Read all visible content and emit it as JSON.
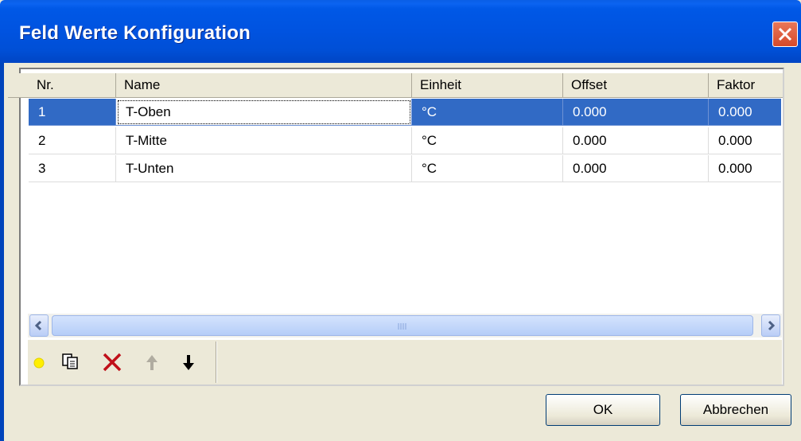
{
  "window": {
    "title": "Feld Werte Konfiguration"
  },
  "table": {
    "columns": [
      "Nr.",
      "Name",
      "Einheit",
      "Offset",
      "Faktor"
    ],
    "rows": [
      {
        "nr": "1",
        "name": "T-Oben",
        "einheit": "°C",
        "offset": "0.000",
        "faktor": "0.000",
        "selected": true
      },
      {
        "nr": "2",
        "name": "T-Mitte",
        "einheit": "°C",
        "offset": "0.000",
        "faktor": "0.000",
        "selected": false
      },
      {
        "nr": "3",
        "name": "T-Unten",
        "einheit": "°C",
        "offset": "0.000",
        "faktor": "0.000",
        "selected": false
      }
    ]
  },
  "toolbar": {
    "icons": [
      "new-icon",
      "copy-icon",
      "delete-icon",
      "move-up-icon",
      "move-down-icon"
    ]
  },
  "buttons": {
    "ok": "OK",
    "cancel": "Abbrechen"
  },
  "colors": {
    "selection": "#316ac5",
    "title_bar": "#0053e0",
    "close_button": "#d64a2a"
  }
}
